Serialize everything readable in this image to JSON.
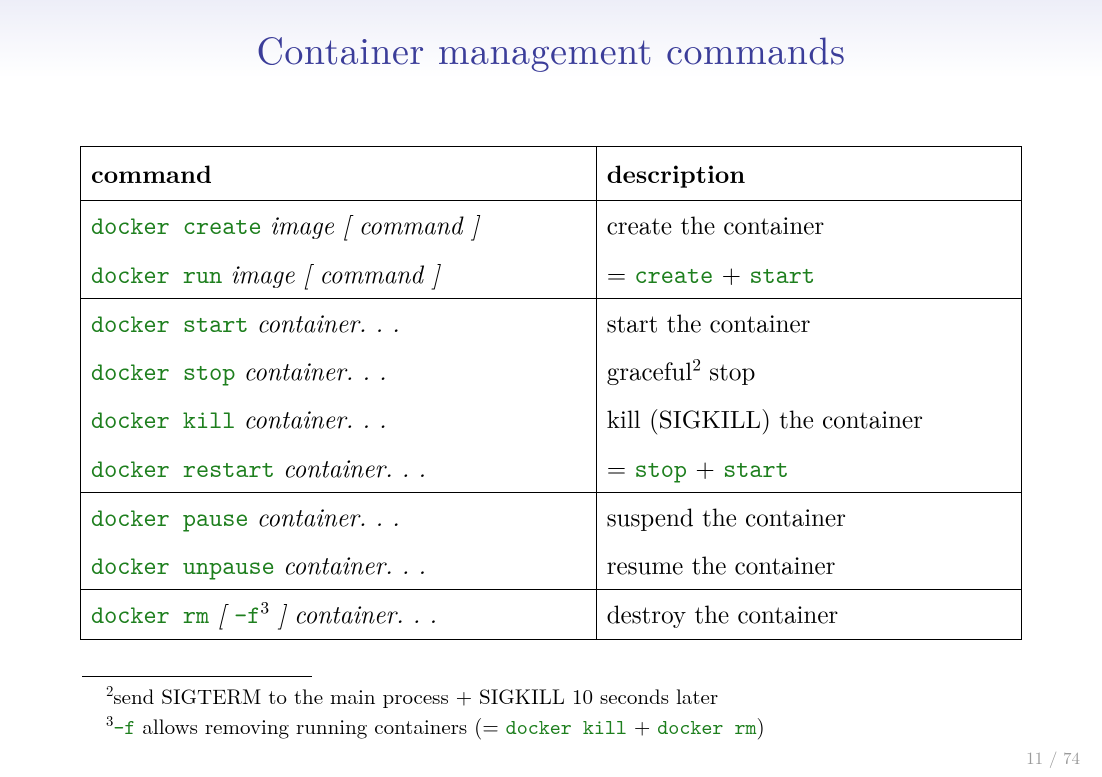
{
  "title": "Container management commands",
  "headers": {
    "command": "command",
    "description": "description"
  },
  "rows": [
    {
      "cmd_tt": "docker create",
      "cmd_it": "image",
      "cmd_tail": "[ command ]",
      "desc_plain": "create the container"
    },
    {
      "cmd_tt": "docker run",
      "cmd_it": "image",
      "cmd_tail": "[ command ]",
      "desc_eq": "= ",
      "desc_tt1": "create",
      "desc_plus": " + ",
      "desc_tt2": "start"
    },
    {
      "cmd_tt": "docker start",
      "cmd_it": "container. . .",
      "desc_plain": "start the container"
    },
    {
      "cmd_tt": "docker stop",
      "cmd_it": "container. . .",
      "desc_pre": "graceful",
      "desc_sup": "2",
      "desc_post": " stop"
    },
    {
      "cmd_tt": "docker kill",
      "cmd_it": "container. . .",
      "desc_plain": "kill (SIGKILL) the container"
    },
    {
      "cmd_tt": "docker restart",
      "cmd_it": "container. . .",
      "desc_eq": "= ",
      "desc_tt1": "stop",
      "desc_plus": " + ",
      "desc_tt2": "start"
    },
    {
      "cmd_tt": "docker pause",
      "cmd_it": "container. . .",
      "desc_plain": "suspend the container"
    },
    {
      "cmd_tt": "docker unpause",
      "cmd_it": "container. . .",
      "desc_plain": "resume the container"
    },
    {
      "cmd_tt": "docker rm",
      "cmd_tail_pre": "[ ",
      "cmd_tail_tt": "-f",
      "cmd_tail_sup": "3",
      "cmd_tail_post": " ]",
      "cmd_it": "container. . .",
      "desc_plain": "destroy the container"
    }
  ],
  "footnotes": {
    "fn2_sup": "2",
    "fn2_text": "send SIGTERM to the main process + SIGKILL 10 seconds later",
    "fn3_sup": "3",
    "fn3_tt1": "-f",
    "fn3_mid": " allows removing running containers (= ",
    "fn3_tt2": "docker kill",
    "fn3_plus": " + ",
    "fn3_tt3": "docker rm",
    "fn3_end": ")"
  },
  "page": "11 / 74"
}
